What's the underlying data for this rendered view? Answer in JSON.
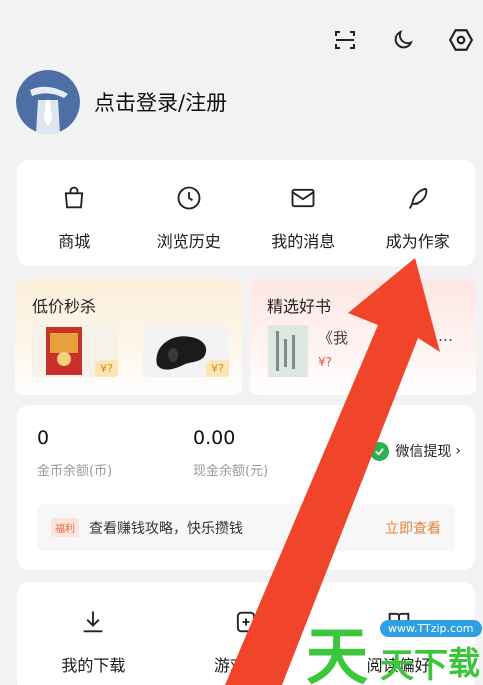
{
  "top_icons": [
    "scan-icon",
    "moon-icon",
    "settings-icon"
  ],
  "profile": {
    "login_text": "点击登录/注册"
  },
  "nav": [
    {
      "label": "商城",
      "icon": "bag-icon"
    },
    {
      "label": "浏览历史",
      "icon": "clock-icon"
    },
    {
      "label": "我的消息",
      "icon": "mail-icon"
    },
    {
      "label": "成为作家",
      "icon": "feather-pen-icon"
    }
  ],
  "promo": {
    "flash_sale": {
      "title": "低价秒杀",
      "items": [
        {
          "price": "¥?"
        },
        {
          "price": "¥?"
        }
      ]
    },
    "featured_books": {
      "title": "精选好书",
      "book_title": "《我",
      "ellipsis": "…",
      "book_price": "¥?"
    }
  },
  "wallet": {
    "coins_value": "0",
    "coins_label": "金币余额(币)",
    "cash_value": "0.00",
    "cash_label": "现金余额(元)",
    "withdraw_label": "微信提现",
    "welfare_tag": "福利",
    "welfare_text": "查看赚钱攻略，快乐攒钱",
    "welfare_action": "立即查看"
  },
  "bottom_nav": [
    {
      "label": "我的下载",
      "icon": "download-icon"
    },
    {
      "label": "游戏中心",
      "icon": "gamepad-icon"
    },
    {
      "label": "阅读偏好",
      "icon": "book-icon"
    }
  ],
  "watermark": {
    "chars": [
      "天",
      "天",
      "下",
      "载"
    ],
    "url": "www.TTzip.com"
  },
  "colors": {
    "arrow": "#f0452b",
    "accent_orange": "#e5823d",
    "wechat_green": "#2bb153"
  }
}
